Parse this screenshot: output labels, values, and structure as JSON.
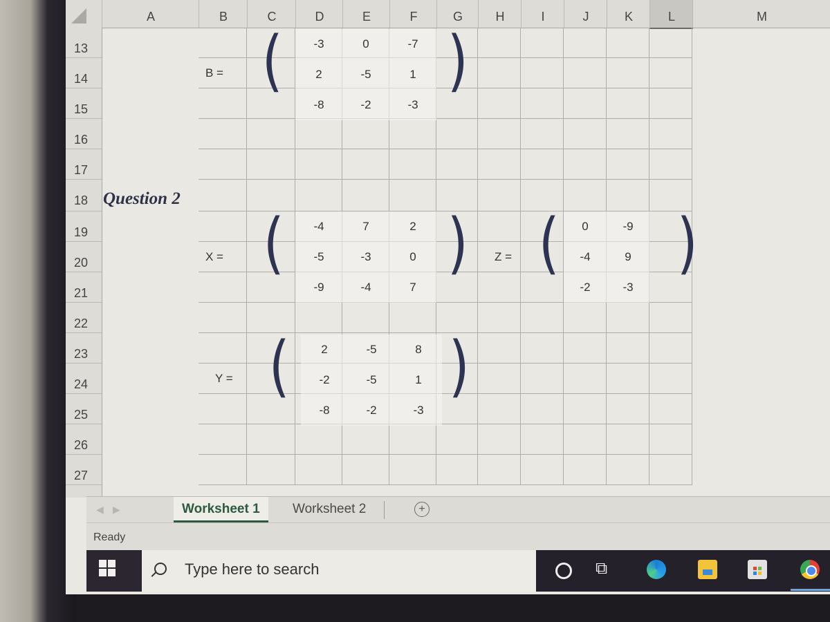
{
  "columns": [
    "A",
    "B",
    "C",
    "D",
    "E",
    "F",
    "G",
    "H",
    "I",
    "J",
    "K",
    "L",
    "M"
  ],
  "selected_column": "L",
  "rows": [
    "13",
    "14",
    "15",
    "16",
    "17",
    "18",
    "19",
    "20",
    "21",
    "22",
    "23",
    "24",
    "25",
    "26",
    "27"
  ],
  "question_label": "Question 2",
  "matrices": {
    "B": {
      "label": "B =",
      "values": [
        [
          "-3",
          "0",
          "-7"
        ],
        [
          "2",
          "-5",
          "1"
        ],
        [
          "-8",
          "-2",
          "-3"
        ]
      ]
    },
    "X": {
      "label": "X =",
      "values": [
        [
          "-4",
          "7",
          "2"
        ],
        [
          "-5",
          "-3",
          "0"
        ],
        [
          "-9",
          "-4",
          "7"
        ]
      ]
    },
    "Z": {
      "label": "Z =",
      "values": [
        [
          "0",
          "-9"
        ],
        [
          "-4",
          "9"
        ],
        [
          "-2",
          "-3"
        ]
      ]
    },
    "Y": {
      "label": "Y =",
      "values": [
        [
          "2",
          "-5",
          "8"
        ],
        [
          "-2",
          "-5",
          "1"
        ],
        [
          "-8",
          "-2",
          "-3"
        ]
      ]
    }
  },
  "paren_open": "(",
  "paren_close": ")",
  "sheet_tabs": [
    {
      "label": "Worksheet 1",
      "active": true
    },
    {
      "label": "Worksheet 2",
      "active": false
    }
  ],
  "add_sheet_label": "+",
  "nav_prev": "◀",
  "nav_next": "▶",
  "status": "Ready",
  "taskbar": {
    "search_placeholder": "Type here to search",
    "icons": [
      "cortana-icon",
      "task-view-icon",
      "edge-icon",
      "file-explorer-icon",
      "store-icon",
      "chrome-icon"
    ],
    "taskview_glyph": "⧉"
  }
}
